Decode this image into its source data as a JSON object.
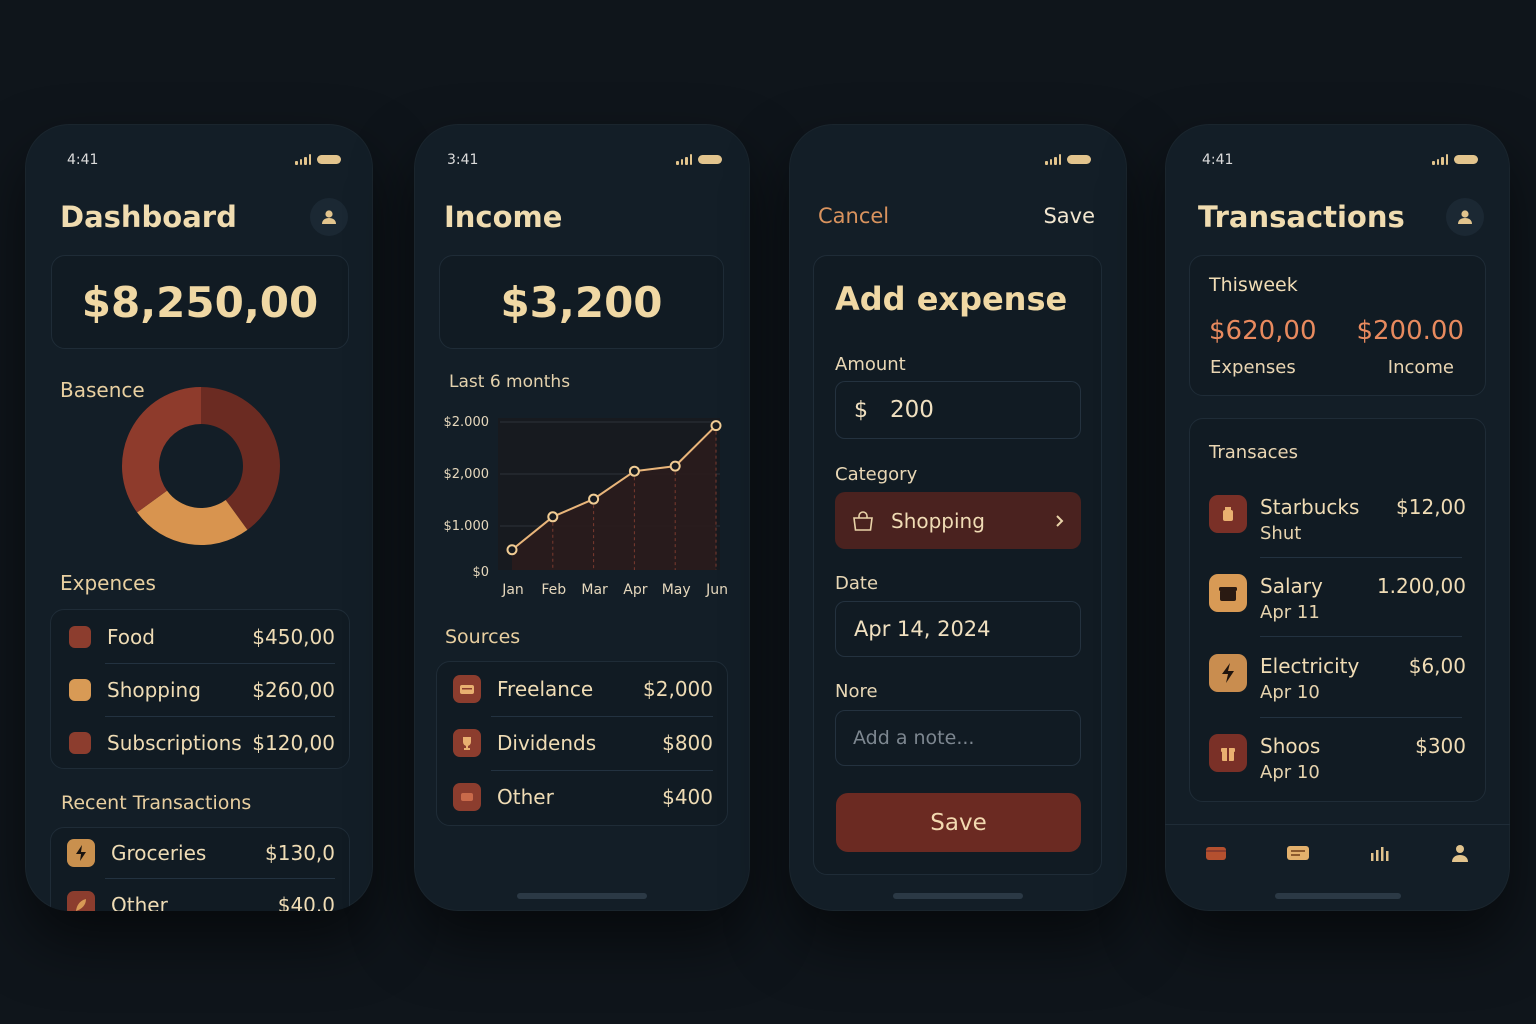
{
  "dashboard": {
    "time": "4:41",
    "title": "Dashboard",
    "balance": "$8,250,00",
    "chart_label": "Basence",
    "expenses_label": "Expences",
    "expenses": [
      {
        "name": "Food",
        "value": "$450,00",
        "color": "#8c3d2e"
      },
      {
        "name": "Shopping",
        "value": "$260,00",
        "color": "#d89a55"
      },
      {
        "name": "Subscriptions",
        "value": "$120,00",
        "color": "#8c3d2e"
      }
    ],
    "recent_label": "Recent Transactions",
    "recent": [
      {
        "name": "Groceries",
        "value": "$130,0",
        "icon": "bolt-icon"
      },
      {
        "name": "Other",
        "value": "$40.0",
        "icon": "leaf-icon"
      }
    ]
  },
  "income": {
    "time": "3:41",
    "title": "Income",
    "total": "$3,200",
    "chart_caption": "Last 6 months",
    "sources_label": "Sources",
    "sources": [
      {
        "name": "Freelance",
        "value": "$2,000",
        "icon": "wallet-icon"
      },
      {
        "name": "Dividends",
        "value": "$800",
        "icon": "trophy-icon"
      },
      {
        "name": "Other",
        "value": "$400",
        "icon": "card-icon"
      }
    ]
  },
  "add_expense": {
    "cancel": "Cancel",
    "save_top": "Save",
    "title": "Add expense",
    "amount_label": "Amount",
    "currency": "$",
    "amount_value": "200",
    "category_label": "Category",
    "category_value": "Shopping",
    "date_label": "Date",
    "date_value": "Apr 14, 2024",
    "note_label": "Nore",
    "note_placeholder": "Add a note...",
    "save_button": "Save"
  },
  "transactions": {
    "time": "4:41",
    "title": "Transactions",
    "week_label": "Thisweek",
    "expenses_amount": "$620,00",
    "expenses_label": "Expenses",
    "income_amount": "$200.00",
    "income_label": "Income",
    "list_label": "Transaces",
    "items": [
      {
        "name": "Starbucks",
        "sub": "Shut",
        "value": "$12,00",
        "icon": "cup-icon"
      },
      {
        "name": "Salary",
        "sub": "Apr 11",
        "value": "1.200,00",
        "icon": "box-icon"
      },
      {
        "name": "Electricity",
        "sub": "Apr 10",
        "value": "$6,00",
        "icon": "bolt-icon"
      },
      {
        "name": "Shoos",
        "sub": "Apr 10",
        "value": "$300",
        "icon": "gift-icon"
      }
    ],
    "nav": [
      "wallet-icon",
      "card-icon",
      "stats-icon",
      "profile-icon"
    ]
  },
  "chart_data": [
    {
      "type": "pie",
      "title": "Basence",
      "values": [
        40,
        25,
        35
      ],
      "colors": [
        "#6b2b22",
        "#d8944f",
        "#8e3b2c"
      ]
    },
    {
      "type": "line",
      "title": "Last 6 months",
      "categories": [
        "Jan",
        "Feb",
        "Mar",
        "Apr",
        "May",
        "Jun"
      ],
      "series": [
        {
          "values": [
            400,
            1050,
            1400,
            1950,
            2050,
            2850
          ]
        }
      ],
      "y_tick_labels": [
        "$2.000",
        "$2,000",
        "$1.000",
        "$0"
      ],
      "ylim": [
        0,
        3000
      ],
      "grid": true
    }
  ]
}
